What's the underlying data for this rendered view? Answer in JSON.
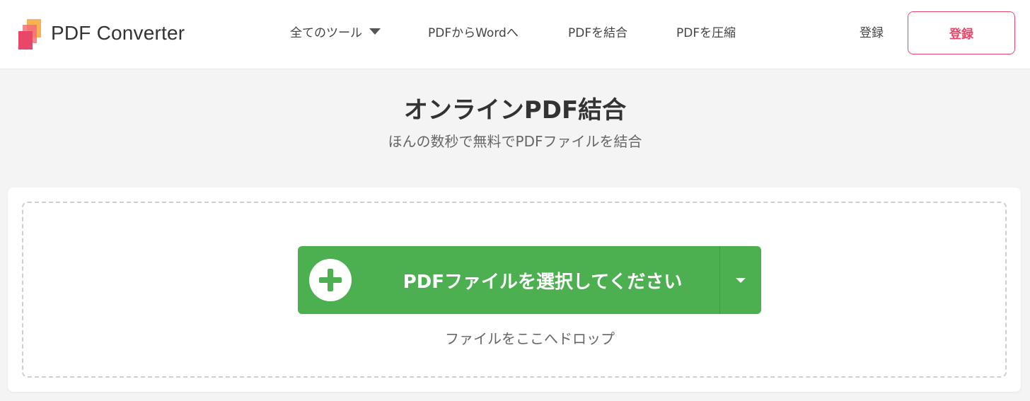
{
  "header": {
    "brand": "PDF Converter",
    "nav": [
      {
        "label": "全てのツール"
      },
      {
        "label": "PDFからWordへ"
      },
      {
        "label": "PDFを結合"
      },
      {
        "label": "PDFを圧縮"
      }
    ],
    "login_label": "登録",
    "register_label": "登録"
  },
  "hero": {
    "title": "オンラインPDF結合",
    "subtitle": "ほんの数秒で無料でPDFファイルを結合"
  },
  "upload": {
    "select_label": "PDFファイルを選択してください",
    "drop_hint": "ファイルをここへドロップ"
  },
  "colors": {
    "accent_green": "#4caf50",
    "brand_pink": "#e8476a",
    "logo_orange": "#f7a940"
  },
  "icons": {
    "logo": "pdf-converter-logo",
    "nav_dropdown": "caret-down-icon",
    "add": "plus-circle-icon",
    "select_dropdown": "caret-down-icon"
  }
}
